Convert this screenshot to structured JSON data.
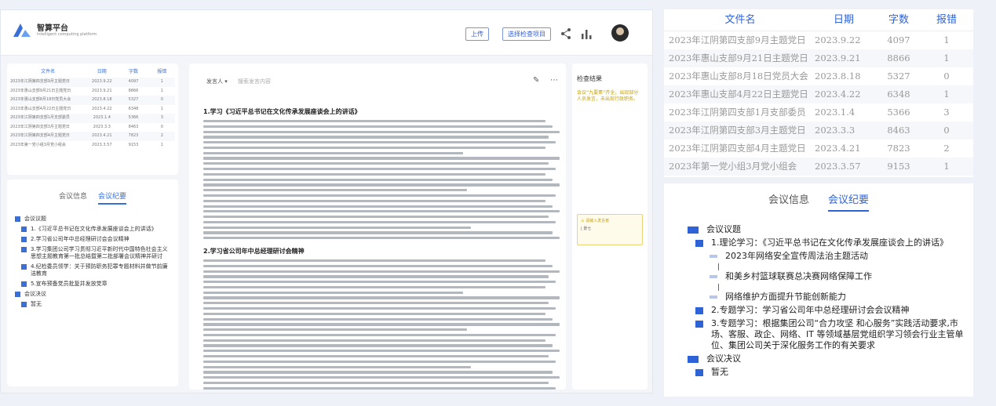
{
  "brand": {
    "title": "智算平台",
    "subtitle": "Intelligent computing platform"
  },
  "header": {
    "upload_label": "上传",
    "select_label": "选择检查项目"
  },
  "table": {
    "headers": {
      "name": "文件名",
      "date": "日期",
      "count": "字数",
      "error": "报错"
    },
    "rows": [
      {
        "name": "2023年江阴第四支部9月主题党日",
        "date": "2023.9.22",
        "count": "4097",
        "error": "1"
      },
      {
        "name": "2023年惠山支部9月21日主题党日",
        "date": "2023.9.21",
        "count": "8866",
        "error": "1"
      },
      {
        "name": "2023年惠山支部8月18日党员大会",
        "date": "2023.8.18",
        "count": "5327",
        "error": "0"
      },
      {
        "name": "2023年惠山支部4月22日主题党日",
        "date": "2023.4.22",
        "count": "6348",
        "error": "1"
      },
      {
        "name": "2023年江阴第四支部1月支部委员",
        "date": "2023.1.4",
        "count": "5366",
        "error": "3"
      },
      {
        "name": "2023年江阴第四支部3月主题党日",
        "date": "2023.3.3",
        "count": "8463",
        "error": "0"
      },
      {
        "name": "2023年江阴第四支部4月主题党日",
        "date": "2023.4.21",
        "count": "7823",
        "error": "2"
      },
      {
        "name": "2023年第一党小组3月党小组会",
        "date": "2023.3.57",
        "count": "9153",
        "error": "1"
      }
    ]
  },
  "minutes": {
    "tabs": [
      "会议信息",
      "会议纪要"
    ],
    "active_tab": 1,
    "section_topics": "会议议题",
    "items": [
      {
        "text": "1.理论学习：《习近平总书记在文化传承发展座谈会上的讲话》"
      },
      {
        "text": "2023年网络安全宣传周法治主题活动"
      },
      {
        "text": "和美乡村篮球联赛总决赛网络保障工作"
      },
      {
        "text": "网络维护方面提升节能创新能力"
      },
      {
        "text": "2.专题学习：学习省公司年中总经理研讨会会议精神"
      },
      {
        "text": "3.专题学习：根据集团公司“合力攻坚 和心服务”实践活动要求,市场、客服、政企、网络、IT 等领域基层党组织学习领会行业主管单位、集团公司关于深化服务工作的有关要求"
      }
    ],
    "section_decision": "会议决议",
    "decision_value": "暂无"
  },
  "mini_minutes_items": [
    "1.《习近平总书记在文化传承发展座谈会上的讲话》",
    "2.学习省公司年中总经理研讨会会议精神",
    "3.学习集团公司学习贯彻习近平新时代中国特色社会主义思想主题教育第一批总结暨第二批部署会议精神并研讨",
    "4.纪检委员领学：关于预防职务犯罪专题材料并做节前廉洁教育",
    "5.宣布预备党员批复并发放党章"
  ],
  "document": {
    "speaker_label": "发言人 ▾",
    "search_placeholder": "搜索发言内容",
    "heading1": "1.学习《习近平总书记在文化传承发展座谈会上的讲话》",
    "heading2": "2.学习省公司年中总经理研讨会精神"
  },
  "check": {
    "title": "检查结果",
    "text": "会议“九要素”齐全，出现部分人员发言，未出现行政职务。",
    "card_a": "⚠ 请输入发言者",
    "card_b": "| 景七"
  },
  "colors": {
    "accent": "#2e63d8",
    "warn": "#c9a200"
  }
}
